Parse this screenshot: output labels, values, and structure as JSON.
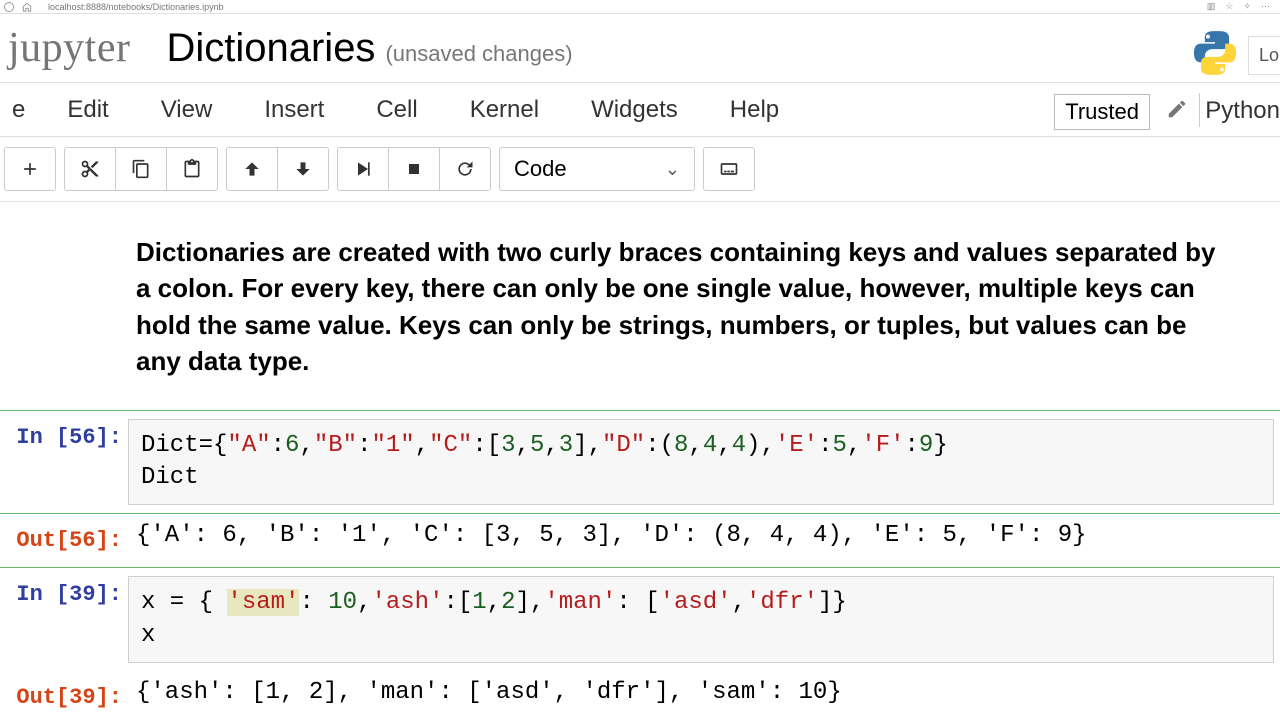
{
  "browser": {
    "url": "localhost:8888/notebooks/Dictionaries.ipynb"
  },
  "header": {
    "logo": "jupyter",
    "title": "Dictionaries",
    "status": "(unsaved changes)",
    "login_stub": "Lo"
  },
  "menu": {
    "items_partial_first": "e",
    "items": [
      "Edit",
      "View",
      "Insert",
      "Cell",
      "Kernel",
      "Widgets",
      "Help"
    ],
    "trusted": "Trusted",
    "kernel": "Python"
  },
  "toolbar": {
    "celltype": "Code"
  },
  "cells": {
    "md_text": "Dictionaries are created with two curly braces containing keys and values separated by a colon. For every key, there can only be one single value, however, multiple keys can hold the same value. Keys can only be strings, numbers, or tuples, but values can be any data type.",
    "cell1": {
      "in_label": "In [56]:",
      "out_label": "Out[56]:",
      "code_plain": "Dict={\"A\":6,\"B\":\"1\",\"C\":[3,5,3],\"D\":(8,4,4),'E':5,'F':9}\nDict",
      "code_tokens": [
        {
          "t": "Dict={",
          "c": ""
        },
        {
          "t": "\"A\"",
          "c": "tok-str"
        },
        {
          "t": ":",
          "c": ""
        },
        {
          "t": "6",
          "c": "tok-num"
        },
        {
          "t": ",",
          "c": ""
        },
        {
          "t": "\"B\"",
          "c": "tok-str"
        },
        {
          "t": ":",
          "c": ""
        },
        {
          "t": "\"1\"",
          "c": "tok-str"
        },
        {
          "t": ",",
          "c": ""
        },
        {
          "t": "\"C\"",
          "c": "tok-str"
        },
        {
          "t": ":[",
          "c": ""
        },
        {
          "t": "3",
          "c": "tok-num"
        },
        {
          "t": ",",
          "c": ""
        },
        {
          "t": "5",
          "c": "tok-num"
        },
        {
          "t": ",",
          "c": ""
        },
        {
          "t": "3",
          "c": "tok-num"
        },
        {
          "t": "],",
          "c": ""
        },
        {
          "t": "\"D\"",
          "c": "tok-str"
        },
        {
          "t": ":(",
          "c": ""
        },
        {
          "t": "8",
          "c": "tok-num"
        },
        {
          "t": ",",
          "c": ""
        },
        {
          "t": "4",
          "c": "tok-num"
        },
        {
          "t": ",",
          "c": ""
        },
        {
          "t": "4",
          "c": "tok-num"
        },
        {
          "t": "),",
          "c": ""
        },
        {
          "t": "'E'",
          "c": "tok-str"
        },
        {
          "t": ":",
          "c": ""
        },
        {
          "t": "5",
          "c": "tok-num"
        },
        {
          "t": ",",
          "c": ""
        },
        {
          "t": "'F'",
          "c": "tok-str"
        },
        {
          "t": ":",
          "c": ""
        },
        {
          "t": "9",
          "c": "tok-num"
        },
        {
          "t": "}",
          "c": ""
        },
        {
          "t": "\n",
          "c": ""
        },
        {
          "t": "Dict",
          "c": ""
        }
      ],
      "output": "{'A': 6, 'B': '1', 'C': [3, 5, 3], 'D': (8, 4, 4), 'E': 5, 'F': 9}"
    },
    "cell2": {
      "in_label": "In [39]:",
      "out_label": "Out[39]:",
      "code_plain": "x = { 'sam': 10,'ash':[1,2],'man': ['asd','dfr']}\nx",
      "code_tokens": [
        {
          "t": "x = { ",
          "c": ""
        },
        {
          "t": "'sam'",
          "c": "tok-str tok-hl"
        },
        {
          "t": ": ",
          "c": ""
        },
        {
          "t": "10",
          "c": "tok-num"
        },
        {
          "t": ",",
          "c": ""
        },
        {
          "t": "'ash'",
          "c": "tok-str"
        },
        {
          "t": ":[",
          "c": ""
        },
        {
          "t": "1",
          "c": "tok-num"
        },
        {
          "t": ",",
          "c": ""
        },
        {
          "t": "2",
          "c": "tok-num"
        },
        {
          "t": "],",
          "c": ""
        },
        {
          "t": "'man'",
          "c": "tok-str"
        },
        {
          "t": ": [",
          "c": ""
        },
        {
          "t": "'asd'",
          "c": "tok-str"
        },
        {
          "t": ",",
          "c": ""
        },
        {
          "t": "'dfr'",
          "c": "tok-str"
        },
        {
          "t": "]}",
          "c": ""
        },
        {
          "t": "\n",
          "c": ""
        },
        {
          "t": "x",
          "c": ""
        }
      ],
      "output": "{'ash': [1, 2], 'man': ['asd', 'dfr'], 'sam': 10}"
    }
  }
}
